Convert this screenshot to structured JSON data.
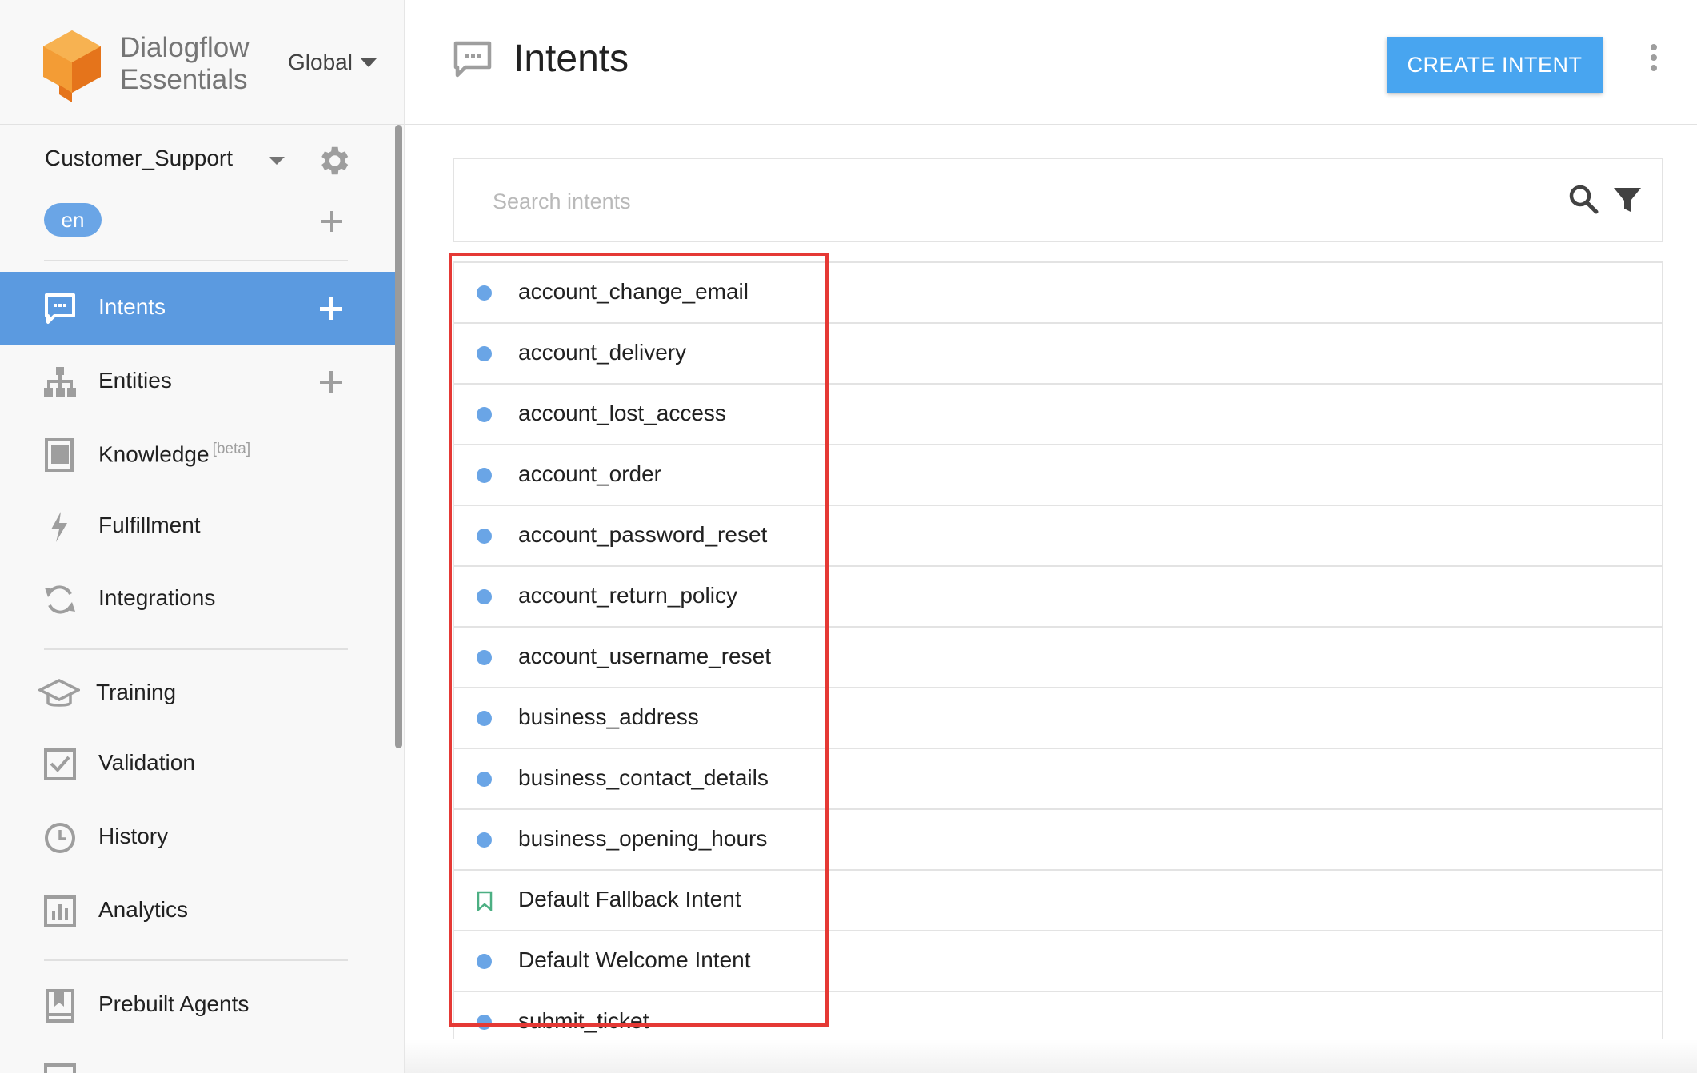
{
  "brand": {
    "line1": "Dialogflow",
    "line2": "Essentials",
    "region": "Global"
  },
  "agent": {
    "name": "Customer_Support",
    "language": "en"
  },
  "nav": [
    {
      "label": "Intents",
      "icon": "chat-bubble-icon",
      "active": true,
      "add": true
    },
    {
      "label": "Entities",
      "icon": "hierarchy-icon",
      "active": false,
      "add": true
    },
    {
      "label": "Knowledge",
      "badge": "[beta]",
      "icon": "book-icon",
      "active": false,
      "add": false
    },
    {
      "label": "Fulfillment",
      "icon": "lightning-icon",
      "active": false,
      "add": false
    },
    {
      "label": "Integrations",
      "icon": "sync-icon",
      "active": false,
      "add": false
    },
    {
      "label": "Training",
      "icon": "graduation-cap-icon",
      "active": false,
      "add": false
    },
    {
      "label": "Validation",
      "icon": "checkbox-icon",
      "active": false,
      "add": false
    },
    {
      "label": "History",
      "icon": "clock-icon",
      "active": false,
      "add": false
    },
    {
      "label": "Analytics",
      "icon": "bar-chart-icon",
      "active": false,
      "add": false
    },
    {
      "label": "Prebuilt Agents",
      "icon": "bookmark-book-icon",
      "active": false,
      "add": false
    }
  ],
  "header": {
    "title": "Intents",
    "create_button": "CREATE INTENT"
  },
  "search": {
    "placeholder": "Search intents",
    "value": ""
  },
  "intents": [
    {
      "name": "account_change_email",
      "marker": "dot"
    },
    {
      "name": "account_delivery",
      "marker": "dot"
    },
    {
      "name": "account_lost_access",
      "marker": "dot"
    },
    {
      "name": "account_order",
      "marker": "dot"
    },
    {
      "name": "account_password_reset",
      "marker": "dot"
    },
    {
      "name": "account_return_policy",
      "marker": "dot"
    },
    {
      "name": "account_username_reset",
      "marker": "dot"
    },
    {
      "name": "business_address",
      "marker": "dot"
    },
    {
      "name": "business_contact_details",
      "marker": "dot"
    },
    {
      "name": "business_opening_hours",
      "marker": "dot"
    },
    {
      "name": "Default Fallback Intent",
      "marker": "bookmark"
    },
    {
      "name": "Default Welcome Intent",
      "marker": "dot"
    },
    {
      "name": "submit_ticket",
      "marker": "dot"
    }
  ],
  "colors": {
    "accent": "#5b9ae0",
    "button": "#48a5f0",
    "dot": "#6aa5e6",
    "fallback": "#4caf83",
    "highlight": "#e53935",
    "logo": "#ef7d22"
  }
}
